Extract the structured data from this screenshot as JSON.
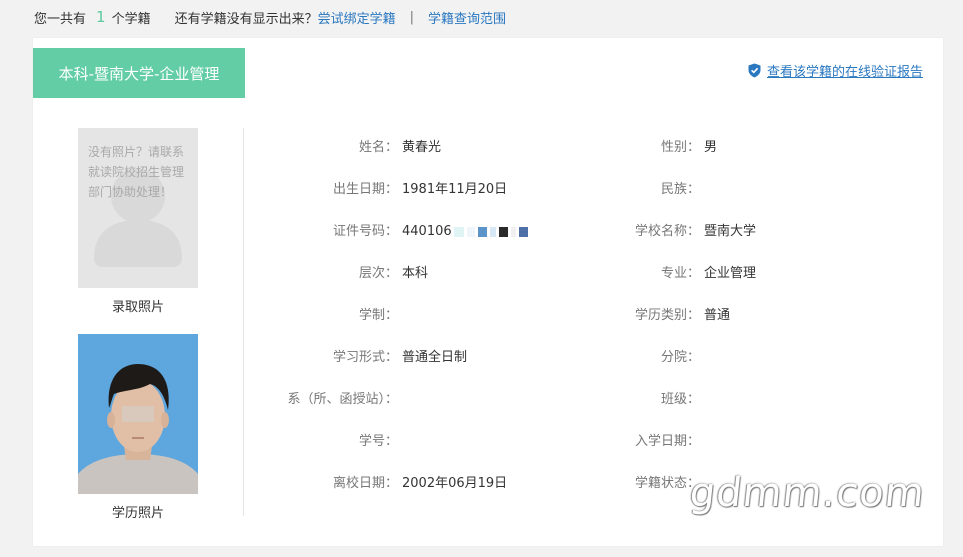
{
  "top_bar": {
    "prefix": "您一共有",
    "count": "1",
    "suffix": "个学籍",
    "question": "还有学籍没有显示出来？",
    "bind_link": "尝试绑定学籍",
    "separator": "|",
    "scope_link": "学籍查询范围"
  },
  "record": {
    "tab_title": "本科-暨南大学-企业管理",
    "verify_link": "查看该学籍的在线验证报告",
    "verify_icon": "shield-check-icon",
    "photos": {
      "placeholder_text": "没有照片？请联系就读院校招生管理部门协助处理！",
      "admission_caption": "录取照片",
      "diploma_caption": "学历照片"
    },
    "fields": {
      "name_label": "姓名：",
      "name_value": "黄春光",
      "gender_label": "性别：",
      "gender_value": "男",
      "birth_label": "出生日期：",
      "birth_value": "1981年11月20日",
      "ethnicity_label": "民族：",
      "ethnicity_value": "",
      "id_label": "证件号码：",
      "id_value": "440106",
      "school_label": "学校名称：",
      "school_value": "暨南大学",
      "level_label": "层次：",
      "level_value": "本科",
      "major_label": "专业：",
      "major_value": "企业管理",
      "duration_label": "学制：",
      "duration_value": "",
      "edu_type_label": "学历类别：",
      "edu_type_value": "普通",
      "study_form_label": "学习形式：",
      "study_form_value": "普通全日制",
      "branch_label": "分院：",
      "branch_value": "",
      "dept_label": "系（所、函授站）：",
      "dept_value": "",
      "class_label": "班级：",
      "class_value": "",
      "student_no_label": "学号：",
      "student_no_value": "",
      "enroll_date_label": "入学日期：",
      "enroll_date_value": "",
      "leave_date_label": "离校日期：",
      "leave_date_value": "2002年06月19日",
      "status_label": "学籍状态：",
      "status_value": ""
    }
  },
  "watermark": "gdmm.com",
  "colors": {
    "tab_bg": "#63cda6",
    "link": "#2a78c0",
    "count": "#5fc9a0"
  }
}
